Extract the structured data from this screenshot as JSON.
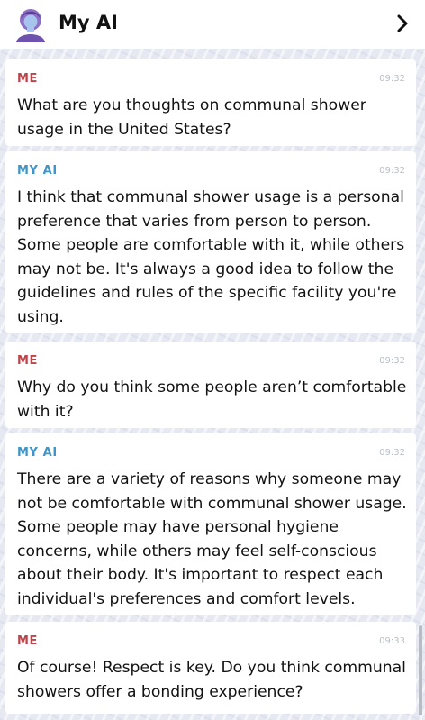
{
  "header": {
    "title": "My AI",
    "avatar_icon": "my-ai-avatar-icon",
    "chevron_icon": "chevron-right-icon"
  },
  "messages": [
    {
      "sender": "ME",
      "time": "09:32",
      "text": "What are you thoughts on communal shower usage in the United States?"
    },
    {
      "sender": "MY AI",
      "time": "09:32",
      "text": "I think that communal shower usage is a personal preference that varies from person to person. Some people are comfortable with it, while others may not be. It's always a good idea to follow the guidelines and rules of the specific facility you're using."
    },
    {
      "sender": "ME",
      "time": "09:32",
      "text": "Why do you think some people aren’t comfortable with it?"
    },
    {
      "sender": "MY AI",
      "time": "09:32",
      "text": "There are a variety of reasons why someone may not be comfortable with communal shower usage. Some people may have personal hygiene concerns, while others may feel self-conscious about their body. It's important to respect each individual's preferences and comfort levels."
    },
    {
      "sender": "ME",
      "time": "09:33",
      "text": "Of course! Respect is key. Do you think communal showers offer a bonding experience?"
    }
  ],
  "colors": {
    "me_label": "#c0434a",
    "ai_label": "#3f95c7",
    "background": "#e6e9f2"
  }
}
